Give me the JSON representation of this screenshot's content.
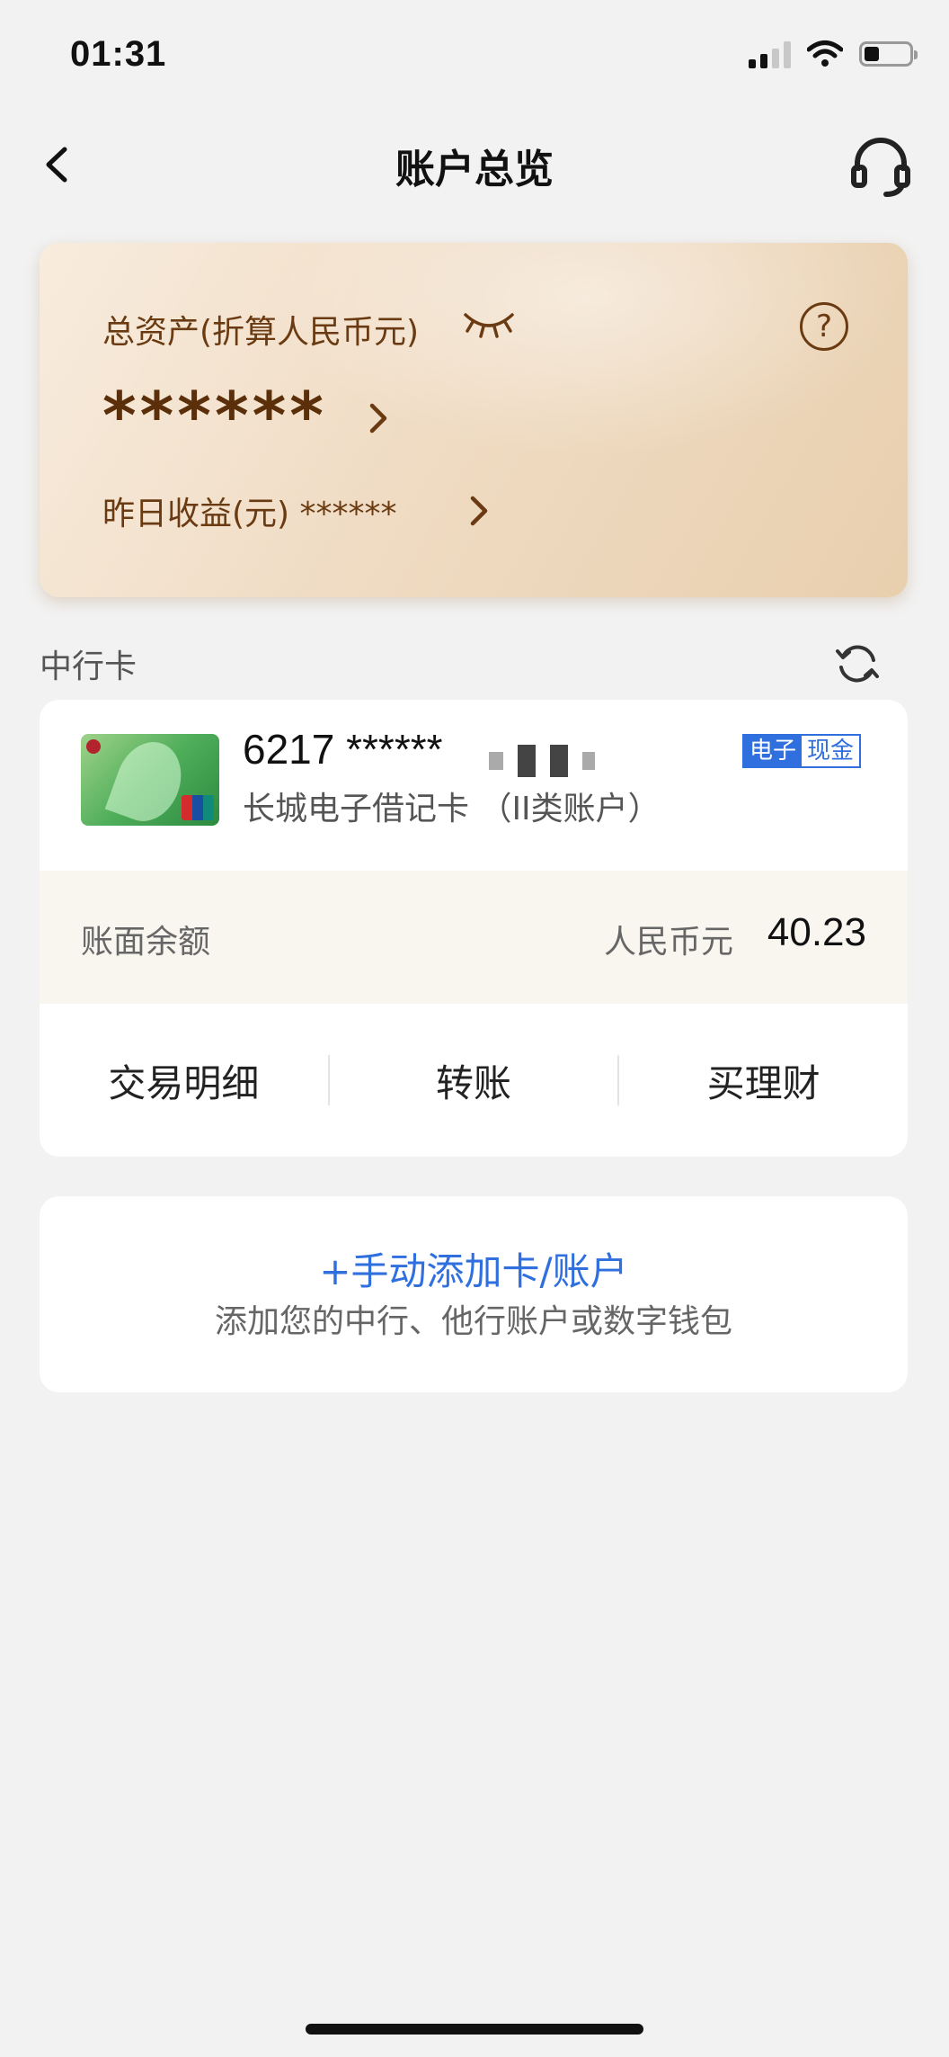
{
  "status_bar": {
    "time": "01:31"
  },
  "nav": {
    "title": "账户总览"
  },
  "assets": {
    "label": "总资产(折算人民币元)",
    "value": "******",
    "yield_label": "昨日收益(元) ******",
    "help_glyph": "?"
  },
  "section": {
    "title": "中行卡"
  },
  "card": {
    "number": "6217 ******",
    "type": "长城电子借记卡 （II类账户）",
    "tags": [
      "电子",
      "现金"
    ],
    "balance_label": "账面余额",
    "currency": "人民币元",
    "balance": "40.23"
  },
  "actions": [
    "交易明细",
    "转账",
    "买理财"
  ],
  "add_account": {
    "title": "+手动添加卡/账户",
    "subtitle": "添加您的中行、他行账户或数字钱包"
  },
  "colors": {
    "accent_blue": "#2f6fde",
    "asset_text": "#6a3b12",
    "background": "#f2f2f2"
  },
  "icons": [
    "back-arrow-icon",
    "headset-icon",
    "eye-closed-icon",
    "help-icon",
    "chevron-right-icon",
    "refresh-icon",
    "signal-icon",
    "wifi-icon",
    "battery-icon"
  ]
}
